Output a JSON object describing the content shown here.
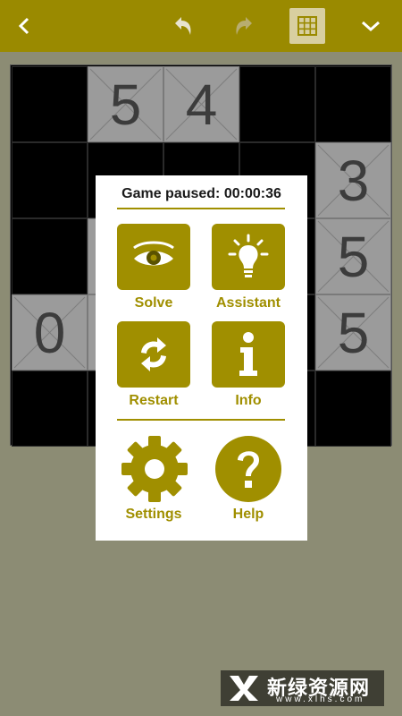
{
  "toolbar": {
    "back_icon": "chevron-left-icon",
    "undo_icon": "undo-icon",
    "redo_icon": "redo-icon",
    "grid_icon": "grid-icon",
    "menu_icon": "chevron-down-icon"
  },
  "board": {
    "rows": 5,
    "cols": 5,
    "cells": [
      [
        "black",
        "5",
        "4",
        "black",
        "black"
      ],
      [
        "black",
        "black",
        "black",
        "black",
        "3"
      ],
      [
        "black",
        "grey",
        "black",
        "black",
        "5"
      ],
      [
        "0",
        "grey",
        "black",
        "black",
        "5"
      ],
      [
        "black",
        "black",
        "black",
        "black",
        "black"
      ]
    ]
  },
  "pause_dialog": {
    "title": "Game paused: 00:00:36",
    "buttons": {
      "solve": "Solve",
      "assistant": "Assistant",
      "restart": "Restart",
      "info": "Info",
      "settings": "Settings",
      "help": "Help"
    }
  },
  "watermark": {
    "name": "新绿资源网",
    "url": "www.xlhs.com"
  },
  "colors": {
    "accent": "#a08f00",
    "toolbar": "#9a8a00",
    "background": "#8c8c74"
  }
}
